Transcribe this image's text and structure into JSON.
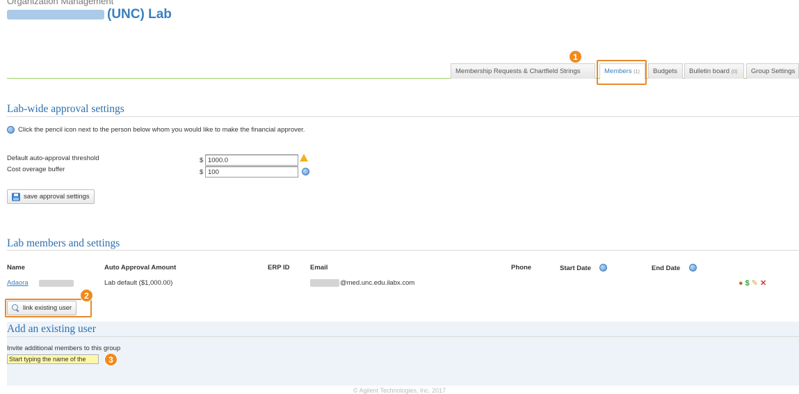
{
  "header": {
    "top_cut": "Organization Management",
    "title_suffix": "(UNC) Lab"
  },
  "tabs": [
    {
      "label": "Membership Requests & Chartfield Strings",
      "count": ""
    },
    {
      "label": "Members",
      "count": "(1)"
    },
    {
      "label": "Budgets",
      "count": ""
    },
    {
      "label": "Bulletin board",
      "count": "(0)"
    },
    {
      "label": "Group Settings",
      "count": ""
    }
  ],
  "steps": {
    "one": "1",
    "two": "2",
    "three": "3"
  },
  "approval": {
    "heading": "Lab-wide approval settings",
    "info": "Click the pencil icon next to the person below whom you would like to make the financial approver.",
    "threshold_label": "Default auto-approval threshold",
    "buffer_label": "Cost overage buffer",
    "currency": "$",
    "threshold_value": "1000.0",
    "buffer_value": "100",
    "save_label": "save approval settings"
  },
  "members": {
    "heading": "Lab members and settings",
    "columns": {
      "name": "Name",
      "auto_approval": "Auto Approval Amount",
      "erp_id": "ERP ID",
      "email": "Email",
      "phone": "Phone",
      "start_date": "Start Date",
      "end_date": "End Date"
    },
    "rows": [
      {
        "name": "Adaora",
        "auto_approval": "Lab default ($1,000.00)",
        "email_suffix": "@med.unc.edu.ilabx.com"
      }
    ],
    "link_existing_label": "link existing user"
  },
  "add_user": {
    "heading": "Add an existing user",
    "invite_label": "Invite additional members to this group",
    "input_value": "Start typing the name of the"
  },
  "footer": "© Agilent Technologies, Inc. 2017",
  "colors": {
    "accent": "#3a7fc0",
    "highlight": "#e8892b",
    "tab_line": "#9ccf6a"
  }
}
